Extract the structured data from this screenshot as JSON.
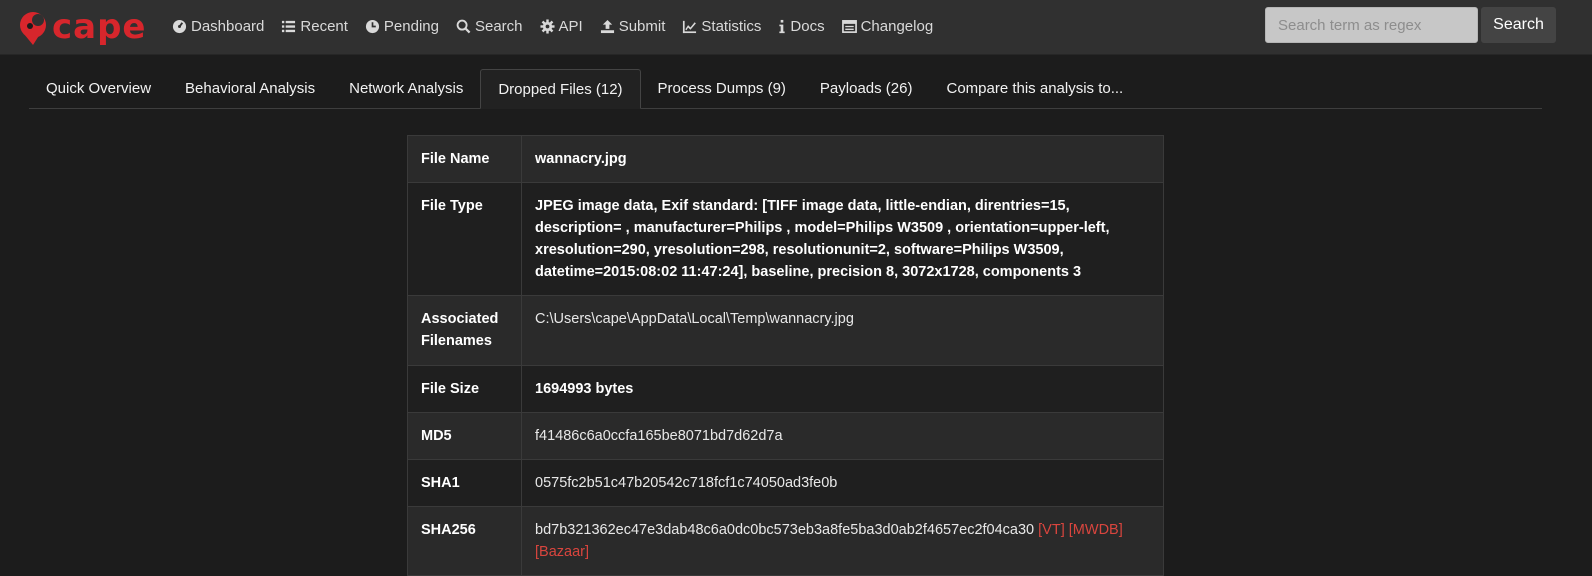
{
  "brand": {
    "name": "cape",
    "color": "#d7262c"
  },
  "nav": [
    {
      "label": "Dashboard",
      "icon": "dashboard-icon"
    },
    {
      "label": "Recent",
      "icon": "list-icon"
    },
    {
      "label": "Pending",
      "icon": "clock-icon"
    },
    {
      "label": "Search",
      "icon": "search-icon"
    },
    {
      "label": "API",
      "icon": "gear-icon"
    },
    {
      "label": "Submit",
      "icon": "upload-icon"
    },
    {
      "label": "Statistics",
      "icon": "chart-icon"
    },
    {
      "label": "Docs",
      "icon": "info-icon"
    },
    {
      "label": "Changelog",
      "icon": "table-icon"
    }
  ],
  "search": {
    "placeholder": "Search term as regex",
    "button": "Search"
  },
  "tabs": [
    {
      "label": "Quick Overview"
    },
    {
      "label": "Behavioral Analysis"
    },
    {
      "label": "Network Analysis"
    },
    {
      "label": "Dropped Files (12)",
      "active": true
    },
    {
      "label": "Process Dumps (9)"
    },
    {
      "label": "Payloads (26)"
    },
    {
      "label": "Compare this analysis to..."
    }
  ],
  "file": {
    "name_label": "File Name",
    "name": "wannacry.jpg",
    "type_label": "File Type",
    "type": "JPEG image data, Exif standard: [TIFF image data, little-endian, direntries=15, description= , manufacturer=Philips , model=Philips W3509 , orientation=upper-left, xresolution=290, yresolution=298, resolutionunit=2, software=Philips W3509, datetime=2015:08:02 11:47:24], baseline, precision 8, 3072x1728, components 3",
    "assoc_label": "Associated Filenames",
    "assoc": "C:\\Users\\cape\\AppData\\Local\\Temp\\wannacry.jpg",
    "size_label": "File Size",
    "size": "1694993 bytes",
    "md5_label": "MD5",
    "md5": "f41486c6a0ccfa165be8071bd7d62d7a",
    "sha1_label": "SHA1",
    "sha1": "0575fc2b51c47b20542c718fcf1c74050ad3fe0b",
    "sha256_label": "SHA256",
    "sha256": "bd7b321362ec47e3dab48c6a0dc0bc573eb3a8fe5ba3d0ab2f4657ec2f04ca30",
    "links": {
      "vt": "[VT]",
      "mwdb": "[MWDB]",
      "bazaar": "[Bazaar]"
    }
  },
  "colors": {
    "link_red": "#d9453e",
    "navbar": "#303030",
    "background": "#1c1c1c"
  }
}
